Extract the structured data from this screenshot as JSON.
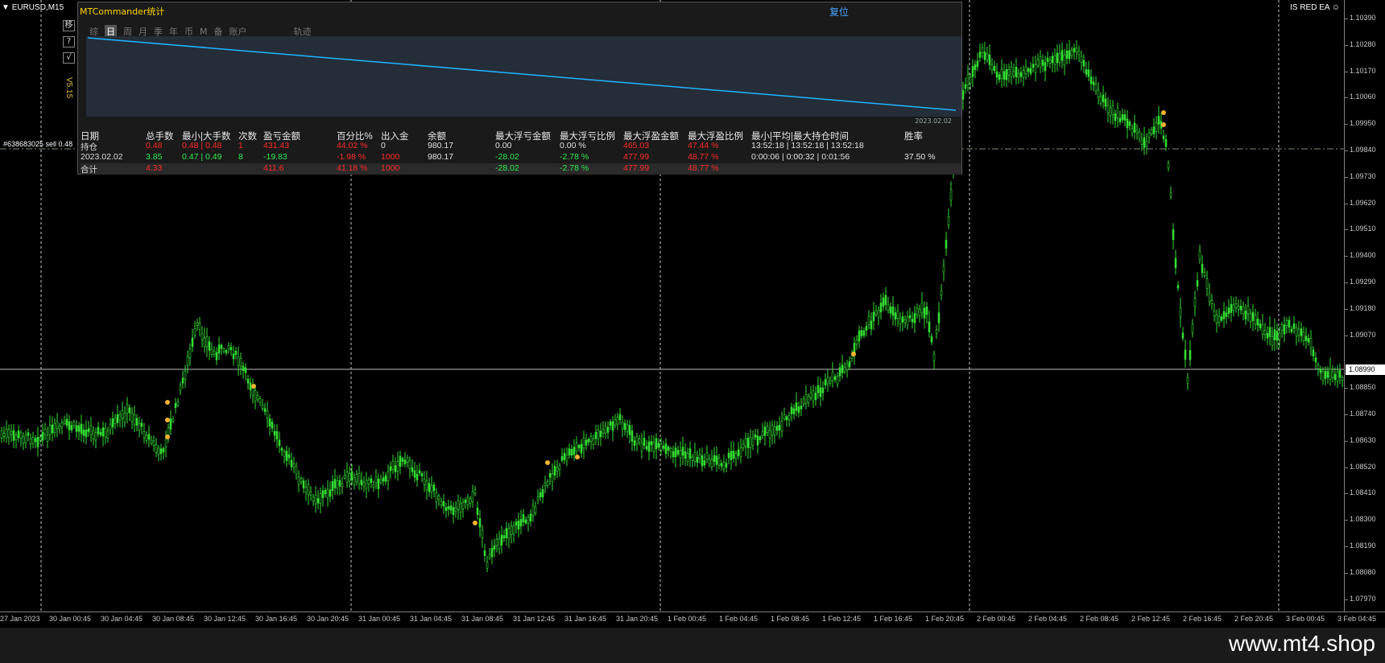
{
  "symbol_label": "EURUSD,M15",
  "ea_label": "IS RED EA",
  "order_label": "#638683025 sell 0.48",
  "version": "V5.15",
  "side_buttons": [
    "移",
    "?",
    "√"
  ],
  "watermark": "www.mt4.shop",
  "price_axis": {
    "ticks": [
      "1.10390",
      "1.10280",
      "1.10170",
      "1.10060",
      "1.09950",
      "1.09840",
      "1.09730",
      "1.09620",
      "1.09510",
      "1.09400",
      "1.09290",
      "1.09180",
      "1.09070",
      "1.08990",
      "1.08850",
      "1.08740",
      "1.08630",
      "1.08520",
      "1.08410",
      "1.08300",
      "1.08190",
      "1.08080",
      "1.07970"
    ],
    "current": "1.08990"
  },
  "time_axis": {
    "ticks": [
      "27 Jan 2023",
      "30 Jan 00:45",
      "30 Jan 04:45",
      "30 Jan 08:45",
      "30 Jan 12:45",
      "30 Jan 16:45",
      "30 Jan 20:45",
      "31 Jan 00:45",
      "31 Jan 04:45",
      "31 Jan 08:45",
      "31 Jan 12:45",
      "31 Jan 16:45",
      "31 Jan 20:45",
      "1 Feb 00:45",
      "1 Feb 04:45",
      "1 Feb 08:45",
      "1 Feb 12:45",
      "1 Feb 16:45",
      "1 Feb 20:45",
      "2 Feb 00:45",
      "2 Feb 04:45",
      "2 Feb 08:45",
      "2 Feb 12:45",
      "2 Feb 16:45",
      "2 Feb 20:45",
      "3 Feb 00:45",
      "3 Feb 04:45"
    ]
  },
  "panel": {
    "title": "MTCommander统计",
    "reset": "复位",
    "tabs": [
      "综",
      "日",
      "周",
      "月",
      "季",
      "年",
      "币",
      "M",
      "备",
      "账户",
      "轨迹"
    ],
    "active_tab": "日",
    "mini_chart_date": "2023.02.02",
    "headers": [
      "日期",
      "总手数",
      "最小|大手数",
      "次数",
      "盈亏金额",
      "百分比%",
      "出入金",
      "余额",
      "最大浮亏金额",
      "最大浮亏比例",
      "最大浮盈金额",
      "最大浮盈比例",
      "最小|平均|最大持仓时间",
      "胜率"
    ],
    "rows": [
      {
        "name": "持仓",
        "cells": [
          "0.48",
          "0.48 | 0.48",
          "1",
          "431.43",
          "44.02 %",
          "0",
          "980.17",
          "0.00",
          "0.00 %",
          "465.03",
          "47.44 %",
          "13:52:18 | 13:52:18 | 13:52:18",
          ""
        ],
        "colors": [
          "red",
          "red",
          "red",
          "red",
          "red",
          "white",
          "white",
          "white",
          "white",
          "red",
          "red",
          "white",
          "white"
        ]
      },
      {
        "name": "2023.02.02",
        "cells": [
          "3.85",
          "0.47 | 0.49",
          "8",
          "-19.83",
          "-1.98 %",
          "1000",
          "980.17",
          "-28.02",
          "-2.78 %",
          "477.99",
          "48.77 %",
          "0:00:06 | 0:00:32 | 0:01:56",
          "37.50 %"
        ],
        "colors": [
          "green",
          "green",
          "green",
          "green",
          "red",
          "red",
          "white",
          "green",
          "green",
          "red",
          "red",
          "white",
          "white"
        ]
      },
      {
        "name": "合计",
        "cells": [
          "4.33",
          "",
          "",
          "411.6",
          "41.18 %",
          "1000",
          "",
          "-28.02",
          "-2.78 %",
          "477.99",
          "48.77 %",
          "",
          ""
        ],
        "colors": [
          "red",
          "red",
          "red",
          "red",
          "red",
          "red",
          "white",
          "green",
          "green",
          "red",
          "red",
          "white",
          "white"
        ]
      }
    ]
  },
  "colors": {
    "candle": "#33dd33",
    "grid": "#c8c8c8",
    "accent_line": "#1fb6ff",
    "title": "#ffd400"
  }
}
